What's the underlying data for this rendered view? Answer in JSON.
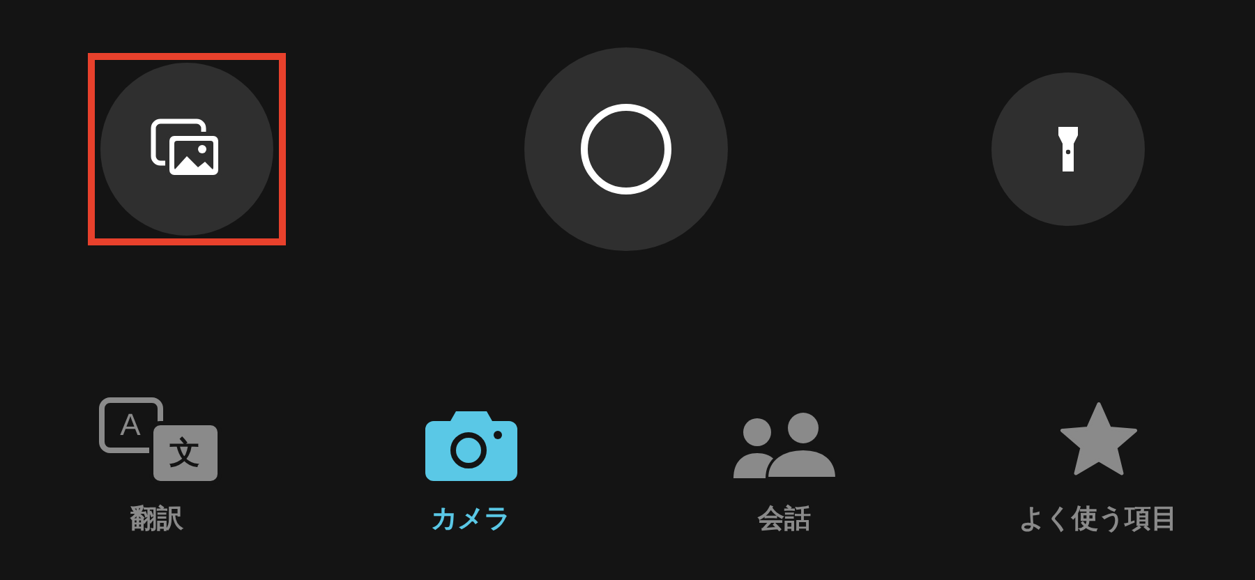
{
  "controls": {
    "gallery": {
      "highlighted": true
    }
  },
  "tabs": [
    {
      "kind": "translate",
      "label": "翻訳",
      "selected": false,
      "glyphs": [
        "A",
        "文"
      ]
    },
    {
      "kind": "camera",
      "label": "カメラ",
      "selected": true
    },
    {
      "kind": "conversation",
      "label": "会話",
      "selected": false
    },
    {
      "kind": "favorites",
      "label": "よく使う項目",
      "selected": false
    }
  ]
}
